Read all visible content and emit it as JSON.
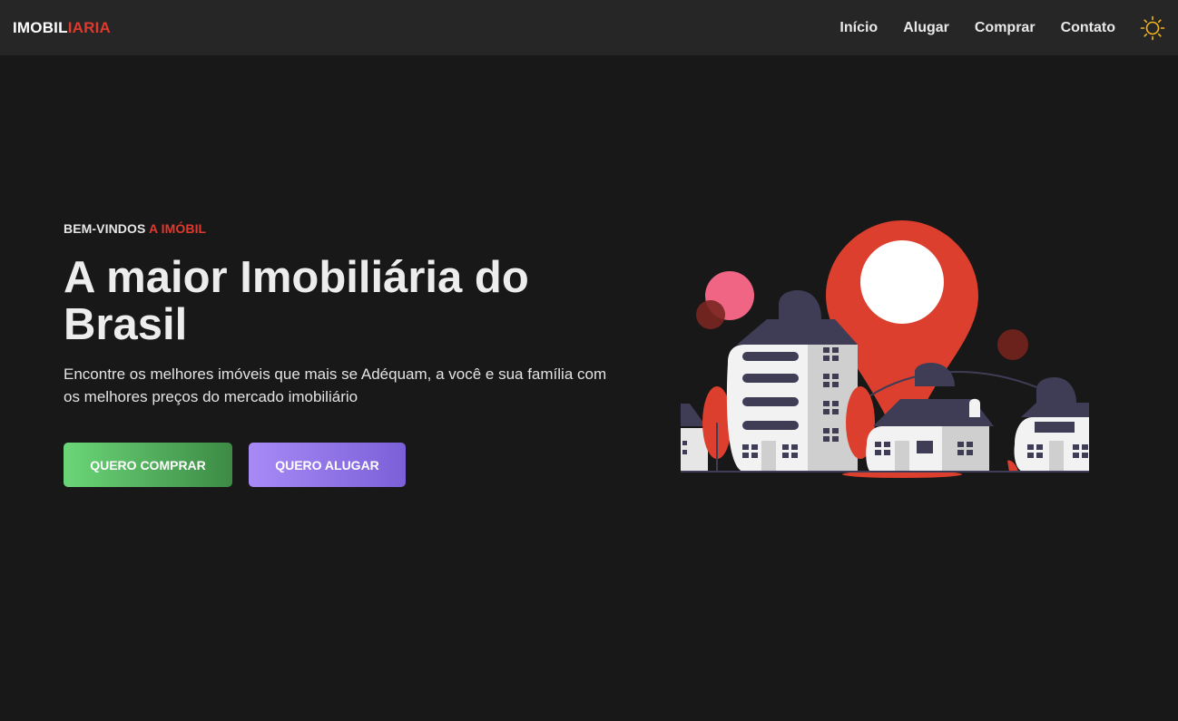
{
  "header": {
    "logo_main": "IMOBIL",
    "logo_accent": "IARIA",
    "nav": [
      "Início",
      "Alugar",
      "Comprar",
      "Contato"
    ],
    "theme_toggle_icon": "sun-icon"
  },
  "hero": {
    "eyebrow_main": "BEM-VINDOS",
    "eyebrow_accent": "A IMÓBIL",
    "headline": "A maior Imobiliária do Brasil",
    "subtitle": "Encontre os melhores imóveis que mais se Adéquam, a você e sua família com os melhores preços do mercado imobiliário",
    "buy_label": "QUERO COMPRAR",
    "rent_label": "QUERO ALUGAR"
  },
  "colors": {
    "background": "#181818",
    "navbar": "#262626",
    "accent": "#e0392d",
    "sun": "#f2b51c",
    "buy_gradient": [
      "#6bd678",
      "#3d8a45"
    ],
    "rent_gradient": [
      "#a88af6",
      "#7a60d8"
    ]
  }
}
